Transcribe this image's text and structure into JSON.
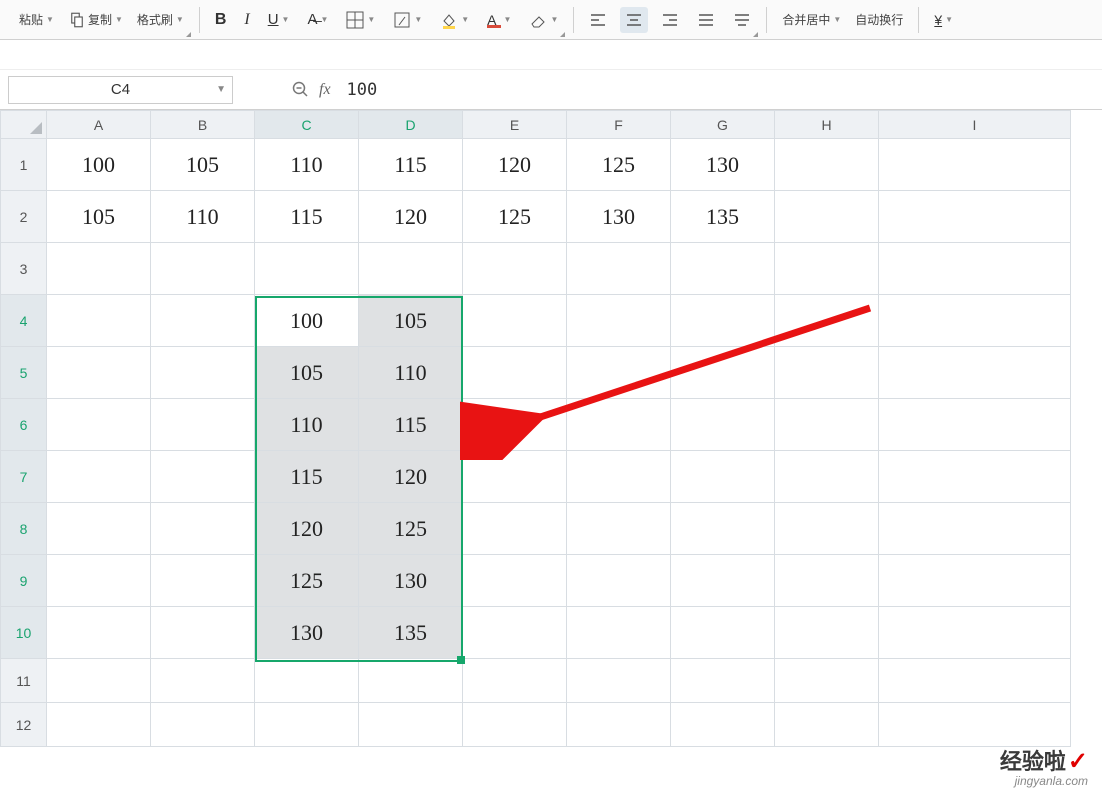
{
  "toolbar": {
    "paste": "粘贴",
    "copy": "复制",
    "format_painter": "格式刷",
    "merge_center": "合并居中",
    "wrap_text": "自动换行",
    "currency_label": "¥"
  },
  "namebox": {
    "value": "C4"
  },
  "formula": {
    "value": "100"
  },
  "columns": [
    "A",
    "B",
    "C",
    "D",
    "E",
    "F",
    "G",
    "H",
    "I"
  ],
  "rows": [
    "1",
    "2",
    "3",
    "4",
    "5",
    "6",
    "7",
    "8",
    "9",
    "10",
    "11",
    "12"
  ],
  "cells": {
    "r1": {
      "A": "100",
      "B": "105",
      "C": "110",
      "D": "115",
      "E": "120",
      "F": "125",
      "G": "130"
    },
    "r2": {
      "A": "105",
      "B": "110",
      "C": "115",
      "D": "120",
      "E": "125",
      "F": "130",
      "G": "135"
    },
    "r3": {},
    "r4": {
      "C": "100",
      "D": "105"
    },
    "r5": {
      "C": "105",
      "D": "110"
    },
    "r6": {
      "C": "110",
      "D": "115"
    },
    "r7": {
      "C": "115",
      "D": "120"
    },
    "r8": {
      "C": "120",
      "D": "125"
    },
    "r9": {
      "C": "125",
      "D": "130"
    },
    "r10": {
      "C": "130",
      "D": "135"
    },
    "r11": {},
    "r12": {}
  },
  "selection": {
    "start": "C4",
    "end": "D10",
    "active": "C4"
  },
  "selected_cols": [
    "C",
    "D"
  ],
  "selected_rows": [
    "4",
    "5",
    "6",
    "7",
    "8",
    "9",
    "10"
  ],
  "watermark": {
    "line1": "经验啦",
    "line2": "jingyanla.com"
  }
}
